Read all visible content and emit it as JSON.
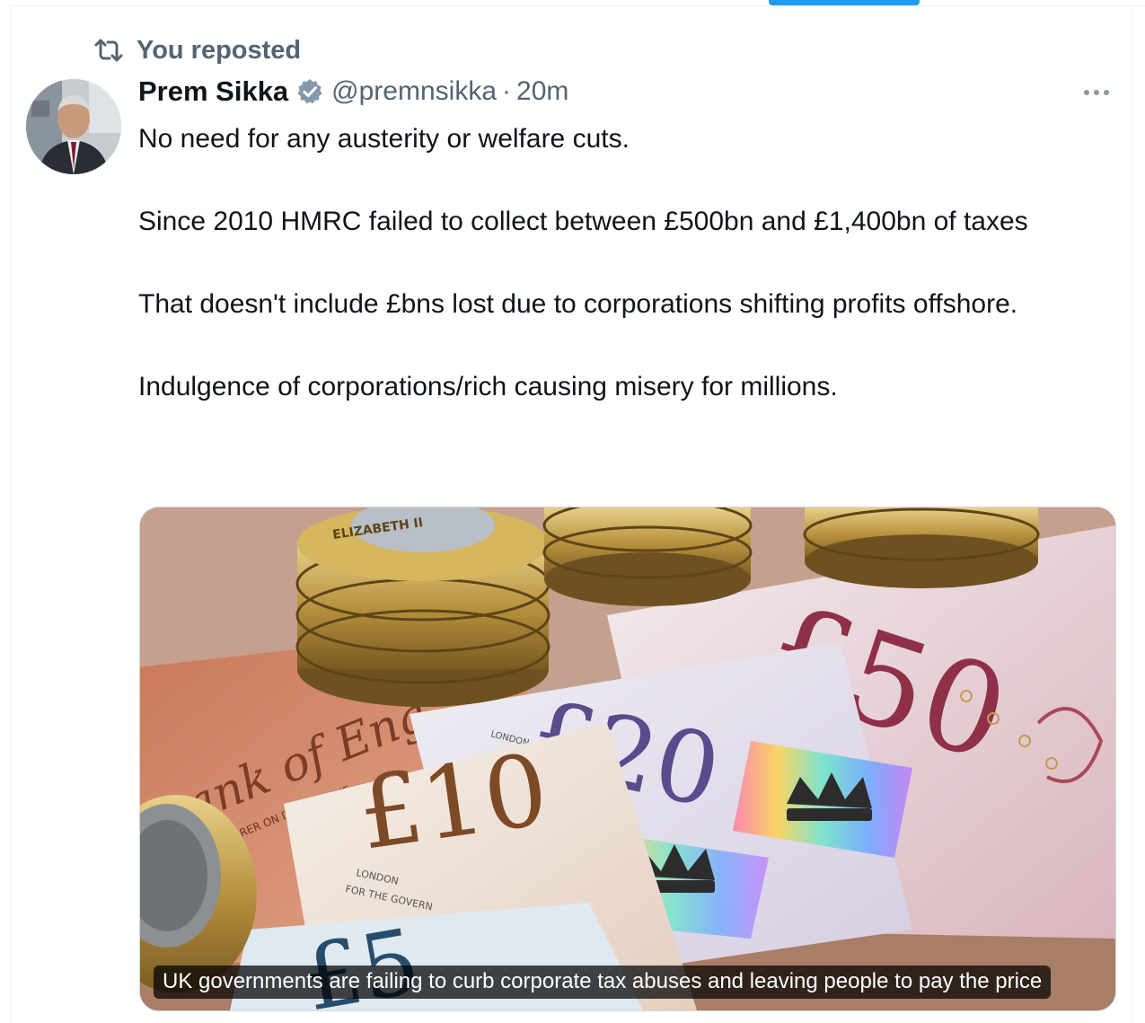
{
  "repost": {
    "label": "You reposted",
    "icon": "repost-icon"
  },
  "author": {
    "display_name": "Prem Sikka",
    "verified": true,
    "handle": "@premnsikka",
    "separator": "·",
    "timestamp": "20m"
  },
  "tweet": {
    "paragraphs": [
      "No need for any austerity or welfare cuts.",
      "Since 2010 HMRC failed to collect between £500bn and £1,400bn of taxes",
      "That doesn't include £bns lost due to corporations shifting profits offshore.",
      "Indulgence of corporations/rich causing misery for millions."
    ]
  },
  "media": {
    "caption": "UK governments are failing to curb corporate tax abuses and leaving people to pay the price",
    "image_text": {
      "note_50": "£50",
      "note_20": "£20",
      "note_10": "£10",
      "note_5": "£5",
      "bank_text": "ank of Eng",
      "bearer_text": "E BEARER ON DEMAND THE",
      "london_1": "LONDON",
      "london_2": "FOR THE GOVERN",
      "coin_text": "ELIZABETH II"
    }
  },
  "colors": {
    "accent": "#1d9bf0",
    "secondary_text": "#536471",
    "primary_text": "#0f1419",
    "verified_badge": "#829aab"
  }
}
